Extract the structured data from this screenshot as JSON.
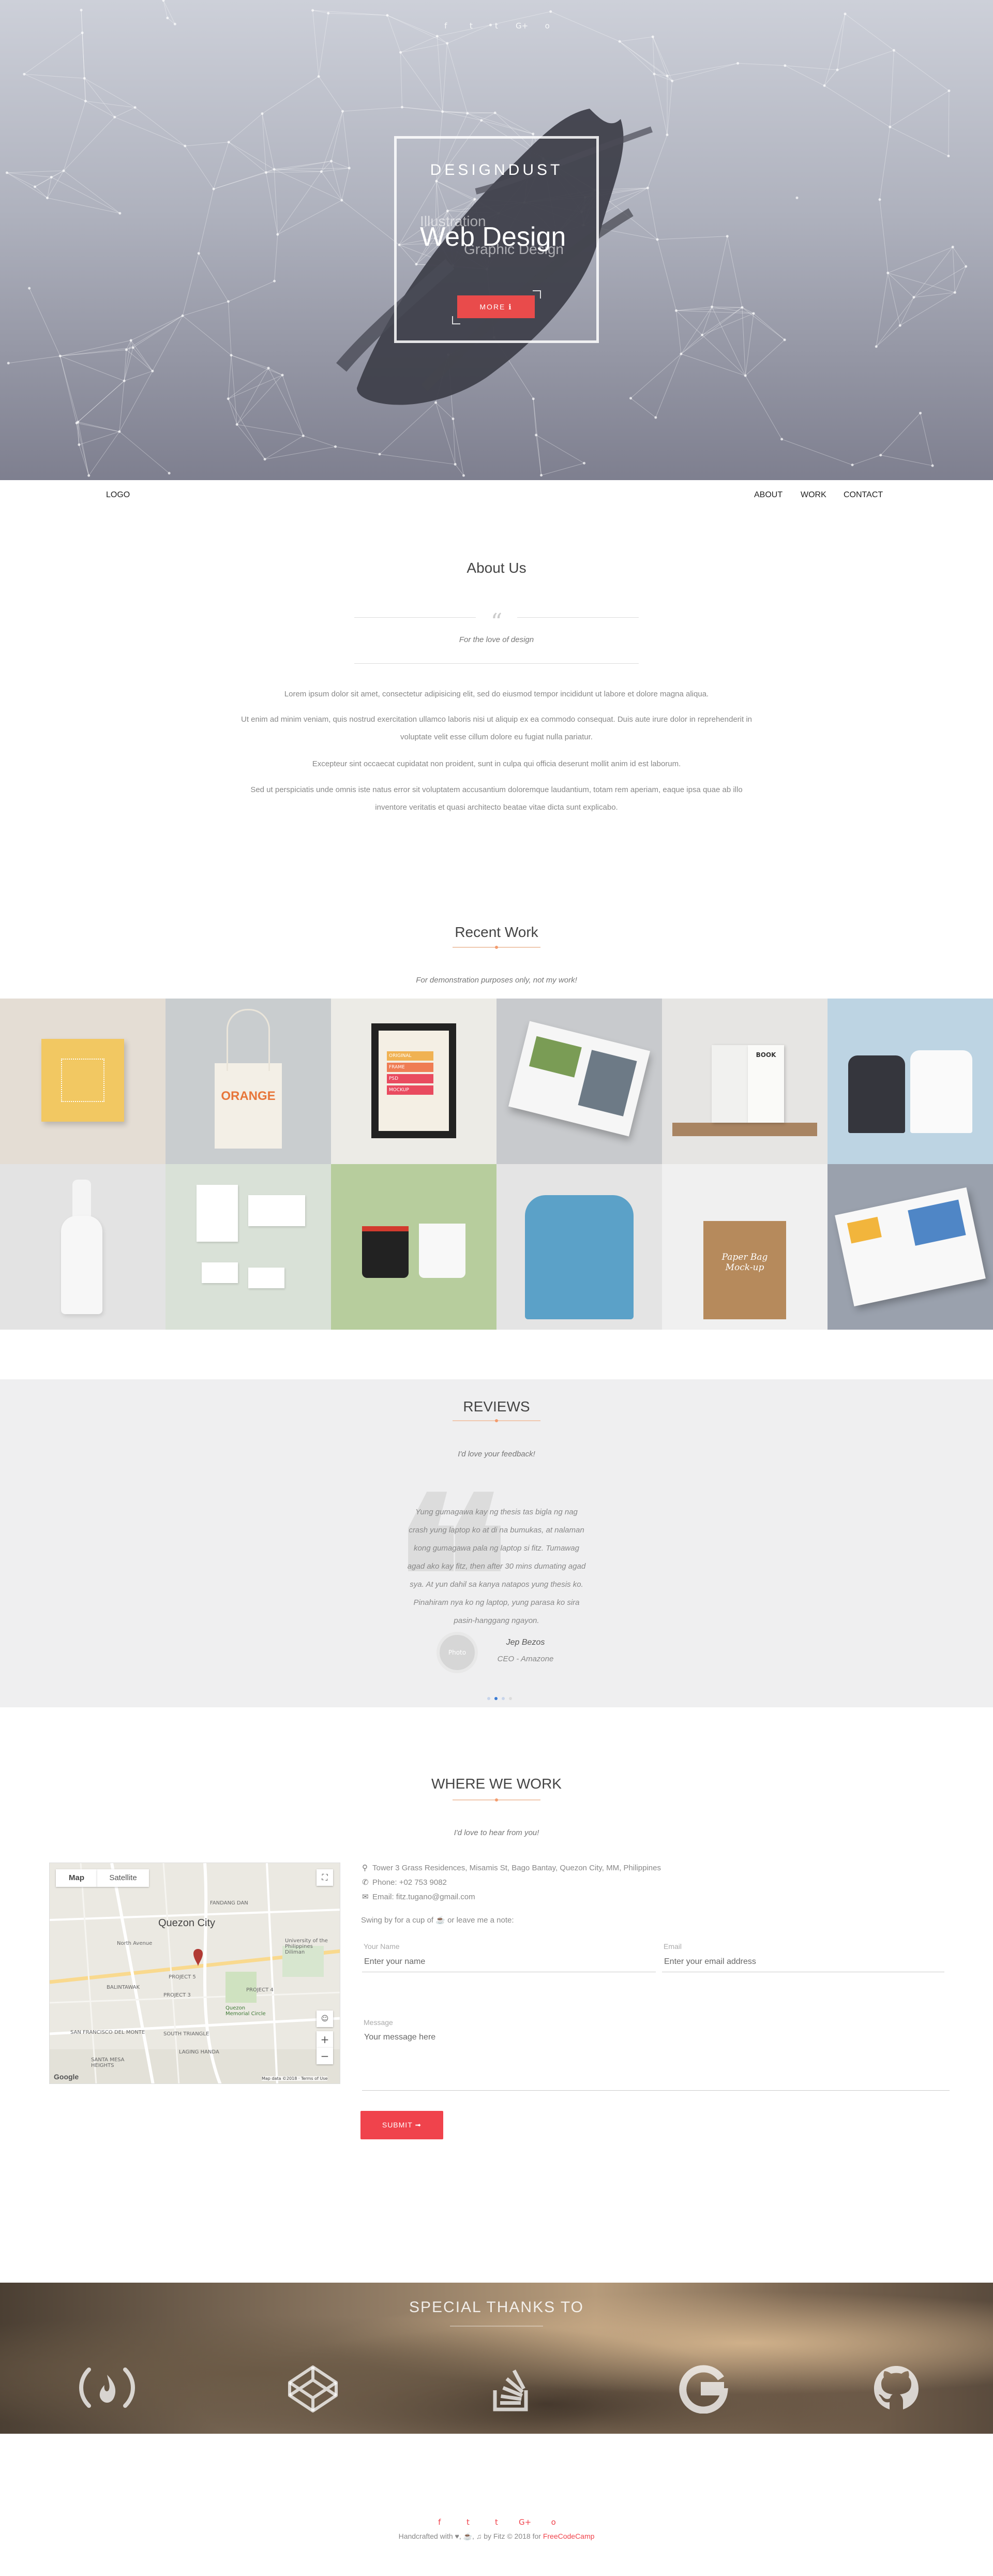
{
  "hero": {
    "social_icons": [
      "f",
      "t",
      "t",
      "G+",
      "o"
    ],
    "brand": "DESIGNDUST",
    "tag_illustration": "Illustration",
    "tag_webdesign": "Web Design",
    "tag_graphic": "Graphic Design",
    "more_label": "MORE",
    "more_icon": "info-icon"
  },
  "nav": {
    "logo": "LOGO",
    "links": [
      "ABOUT",
      "WORK",
      "CONTACT"
    ]
  },
  "about": {
    "title": "About Us",
    "quote_mark": "“",
    "subtitle": "For the love of design",
    "paragraphs": [
      "Lorem ipsum dolor sit amet, consectetur adipisicing elit, sed do eiusmod tempor incididunt ut labore et dolore magna aliqua.",
      "Ut enim ad minim veniam, quis nostrud exercitation ullamco laboris nisi ut aliquip ex ea commodo consequat. Duis aute irure dolor in reprehenderit in",
      "voluptate velit esse cillum dolore eu fugiat nulla pariatur.",
      "Excepteur sint occaecat cupidatat non proident, sunt in culpa qui officia deserunt mollit anim id est laborum.",
      "Sed ut perspiciatis unde omnis iste natus error sit voluptatem accusantium doloremque laudantium, totam rem aperiam, eaque ipsa quae ab illo",
      "inventore veritatis et quasi architecto beatae vitae dicta sunt explicabo."
    ]
  },
  "work": {
    "title": "Recent Work",
    "subtitle": "For demonstration purposes only, not my work!",
    "tiles_row1": [
      "orange-box",
      "tote-bag",
      "poster-frame",
      "magazine",
      "book-shelf",
      "tshirts-hanger"
    ],
    "tiles_row2": [
      "bottle",
      "stationery",
      "mugs",
      "blue-tshirt",
      "paper-bag",
      "brochure"
    ],
    "tote_text": "ORANGE",
    "poster_text": [
      "ORIGINAL",
      "FRAME",
      "PSD",
      "MOCKUP"
    ],
    "book_text": "BOOK",
    "bag_text": "Paper Bag Mock-up"
  },
  "reviews": {
    "title": "REVIEWS",
    "subtitle": "I'd love your feedback!",
    "lines": [
      "Yung gumagawa kay ng thesis tas bigla ng nag",
      "crash yung laptop ko at di na bumukas, at nalaman",
      "kong gumagawa pala ng laptop si fitz. Tumawag",
      "agad ako kay fitz, then after 30 mins dumating agad",
      "sya. At yun dahil sa kanya natapos yung thesis ko.",
      "Pinahiram nya ko ng laptop, yung parasa ko sira",
      "pasin-hanggang ngayon."
    ],
    "avatar_label": "Photo",
    "name": "Jep Bezos",
    "role": "CEO - Amazone"
  },
  "contact": {
    "title": "WHERE WE WORK",
    "subtitle": "I'd love to hear from you!",
    "address": "Tower 3 Grass Residences, Misamis St, Bago Bantay, Quezon City, MM, Philippines",
    "phone": "Phone: +02 753 9082",
    "email": "Email: fitz.tugano@gmail.com",
    "note": "Swing by for a cup of ☕ or leave me a note:",
    "name_label": "Your Name",
    "name_placeholder": "Enter your name",
    "email_label": "Email",
    "email_placeholder": "Enter your email address",
    "message_label": "Message",
    "message_placeholder": "Your message here",
    "submit_label": "SUBMIT ➟"
  },
  "map": {
    "tab_map": "Map",
    "tab_satellite": "Satellite",
    "city_label": "Quezon City",
    "labels": [
      "FANDANG DAN",
      "BALINTAWAK",
      "PROJECT 4",
      "PROJECT 5",
      "Quezon Memorial Circle",
      "PROJECT 3",
      "SOUTH TRIANGLE",
      "SAN FRANCISCO DEL MONTE",
      "LAGING HANDA",
      "SANTA MESA HEIGHTS",
      "University of the Philippines Diliman",
      "North Avenue"
    ],
    "google": "Google",
    "footer": "Map data ©2018 · Terms of Use"
  },
  "thanks": {
    "title": "SPECIAL THANKS TO",
    "logos": [
      "freecodecamp-icon",
      "codepen-icon",
      "stackoverflow-icon",
      "google-icon",
      "github-icon"
    ]
  },
  "footer": {
    "social_icons": [
      "f",
      "t",
      "t",
      "G+",
      "o"
    ],
    "prefix": "Handcrafted with ♥, ☕, ♫ by Fitz © 2018 for ",
    "accent": "FreeCodeCamp"
  }
}
